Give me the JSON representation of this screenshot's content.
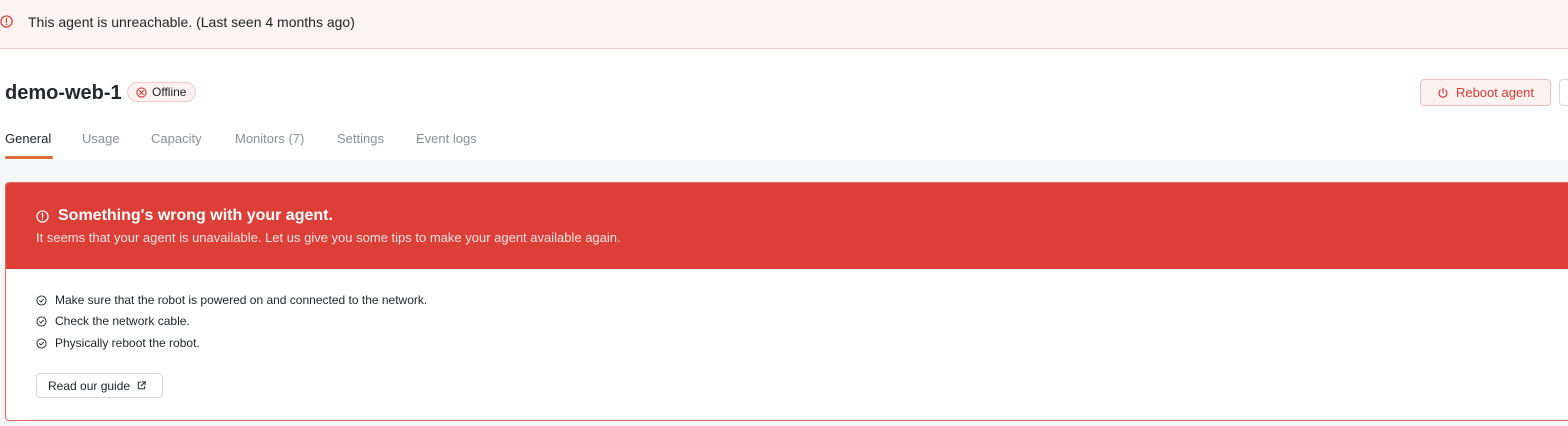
{
  "top_banner": {
    "icon": "alert-circle-icon",
    "message": "This agent is unreachable. (Last seen 4 months ago)"
  },
  "header": {
    "title": "demo-web-1",
    "status": {
      "icon": "x-circle-icon",
      "label": "Offline"
    },
    "reboot_button": {
      "icon": "power-icon",
      "label": "Reboot agent"
    }
  },
  "tabs": [
    {
      "label": "General",
      "active": true
    },
    {
      "label": "Usage"
    },
    {
      "label": "Capacity"
    },
    {
      "label": "Monitors (7)"
    },
    {
      "label": "Settings"
    },
    {
      "label": "Event logs"
    }
  ],
  "alert": {
    "icon": "alert-circle-icon",
    "title": "Something's wrong with your agent.",
    "subtitle": "It seems that your agent is unavailable. Let us give you some tips to make your agent available again.",
    "tips": [
      "Make sure that the robot is powered on and connected to the network.",
      "Check the network cable.",
      "Physically reboot the robot."
    ],
    "guide_button": {
      "label": "Read our guide",
      "icon": "external-link-icon"
    }
  },
  "colors": {
    "banner_bg": "#fdf3f3",
    "danger": "#dc3f38",
    "tab_accent": "#e06a3b"
  }
}
